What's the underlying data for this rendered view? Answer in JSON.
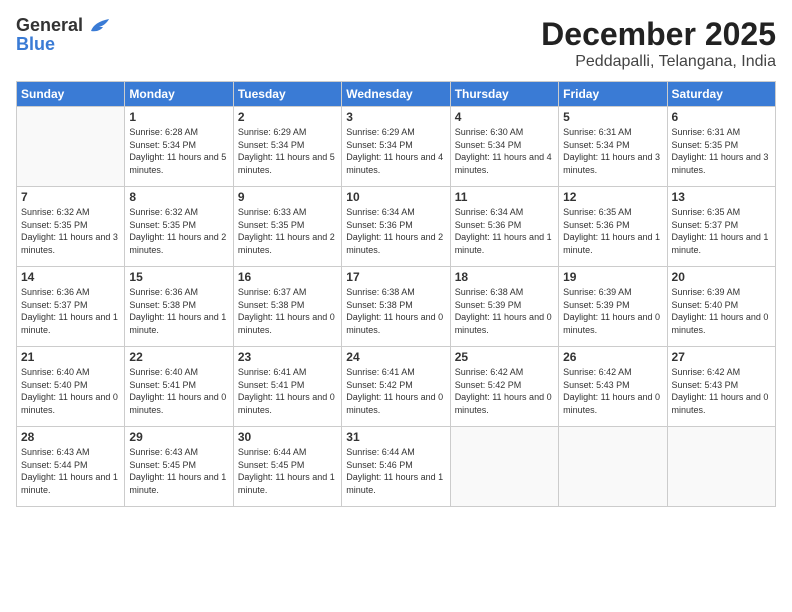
{
  "logo": {
    "general": "General",
    "blue": "Blue"
  },
  "header": {
    "month": "December 2025",
    "location": "Peddapalli, Telangana, India"
  },
  "weekdays": [
    "Sunday",
    "Monday",
    "Tuesday",
    "Wednesday",
    "Thursday",
    "Friday",
    "Saturday"
  ],
  "weeks": [
    [
      {
        "day": null
      },
      {
        "day": 1,
        "sunrise": "6:28 AM",
        "sunset": "5:34 PM",
        "daylight": "11 hours and 5 minutes."
      },
      {
        "day": 2,
        "sunrise": "6:29 AM",
        "sunset": "5:34 PM",
        "daylight": "11 hours and 5 minutes."
      },
      {
        "day": 3,
        "sunrise": "6:29 AM",
        "sunset": "5:34 PM",
        "daylight": "11 hours and 4 minutes."
      },
      {
        "day": 4,
        "sunrise": "6:30 AM",
        "sunset": "5:34 PM",
        "daylight": "11 hours and 4 minutes."
      },
      {
        "day": 5,
        "sunrise": "6:31 AM",
        "sunset": "5:34 PM",
        "daylight": "11 hours and 3 minutes."
      },
      {
        "day": 6,
        "sunrise": "6:31 AM",
        "sunset": "5:35 PM",
        "daylight": "11 hours and 3 minutes."
      }
    ],
    [
      {
        "day": 7,
        "sunrise": "6:32 AM",
        "sunset": "5:35 PM",
        "daylight": "11 hours and 3 minutes."
      },
      {
        "day": 8,
        "sunrise": "6:32 AM",
        "sunset": "5:35 PM",
        "daylight": "11 hours and 2 minutes."
      },
      {
        "day": 9,
        "sunrise": "6:33 AM",
        "sunset": "5:35 PM",
        "daylight": "11 hours and 2 minutes."
      },
      {
        "day": 10,
        "sunrise": "6:34 AM",
        "sunset": "5:36 PM",
        "daylight": "11 hours and 2 minutes."
      },
      {
        "day": 11,
        "sunrise": "6:34 AM",
        "sunset": "5:36 PM",
        "daylight": "11 hours and 1 minute."
      },
      {
        "day": 12,
        "sunrise": "6:35 AM",
        "sunset": "5:36 PM",
        "daylight": "11 hours and 1 minute."
      },
      {
        "day": 13,
        "sunrise": "6:35 AM",
        "sunset": "5:37 PM",
        "daylight": "11 hours and 1 minute."
      }
    ],
    [
      {
        "day": 14,
        "sunrise": "6:36 AM",
        "sunset": "5:37 PM",
        "daylight": "11 hours and 1 minute."
      },
      {
        "day": 15,
        "sunrise": "6:36 AM",
        "sunset": "5:38 PM",
        "daylight": "11 hours and 1 minute."
      },
      {
        "day": 16,
        "sunrise": "6:37 AM",
        "sunset": "5:38 PM",
        "daylight": "11 hours and 0 minutes."
      },
      {
        "day": 17,
        "sunrise": "6:38 AM",
        "sunset": "5:38 PM",
        "daylight": "11 hours and 0 minutes."
      },
      {
        "day": 18,
        "sunrise": "6:38 AM",
        "sunset": "5:39 PM",
        "daylight": "11 hours and 0 minutes."
      },
      {
        "day": 19,
        "sunrise": "6:39 AM",
        "sunset": "5:39 PM",
        "daylight": "11 hours and 0 minutes."
      },
      {
        "day": 20,
        "sunrise": "6:39 AM",
        "sunset": "5:40 PM",
        "daylight": "11 hours and 0 minutes."
      }
    ],
    [
      {
        "day": 21,
        "sunrise": "6:40 AM",
        "sunset": "5:40 PM",
        "daylight": "11 hours and 0 minutes."
      },
      {
        "day": 22,
        "sunrise": "6:40 AM",
        "sunset": "5:41 PM",
        "daylight": "11 hours and 0 minutes."
      },
      {
        "day": 23,
        "sunrise": "6:41 AM",
        "sunset": "5:41 PM",
        "daylight": "11 hours and 0 minutes."
      },
      {
        "day": 24,
        "sunrise": "6:41 AM",
        "sunset": "5:42 PM",
        "daylight": "11 hours and 0 minutes."
      },
      {
        "day": 25,
        "sunrise": "6:42 AM",
        "sunset": "5:42 PM",
        "daylight": "11 hours and 0 minutes."
      },
      {
        "day": 26,
        "sunrise": "6:42 AM",
        "sunset": "5:43 PM",
        "daylight": "11 hours and 0 minutes."
      },
      {
        "day": 27,
        "sunrise": "6:42 AM",
        "sunset": "5:43 PM",
        "daylight": "11 hours and 0 minutes."
      }
    ],
    [
      {
        "day": 28,
        "sunrise": "6:43 AM",
        "sunset": "5:44 PM",
        "daylight": "11 hours and 1 minute."
      },
      {
        "day": 29,
        "sunrise": "6:43 AM",
        "sunset": "5:45 PM",
        "daylight": "11 hours and 1 minute."
      },
      {
        "day": 30,
        "sunrise": "6:44 AM",
        "sunset": "5:45 PM",
        "daylight": "11 hours and 1 minute."
      },
      {
        "day": 31,
        "sunrise": "6:44 AM",
        "sunset": "5:46 PM",
        "daylight": "11 hours and 1 minute."
      },
      {
        "day": null
      },
      {
        "day": null
      },
      {
        "day": null
      }
    ]
  ],
  "labels": {
    "sunrise": "Sunrise:",
    "sunset": "Sunset:",
    "daylight": "Daylight:"
  },
  "colors": {
    "header_bg": "#3a7bd5",
    "header_text": "#ffffff",
    "border": "#cccccc"
  }
}
